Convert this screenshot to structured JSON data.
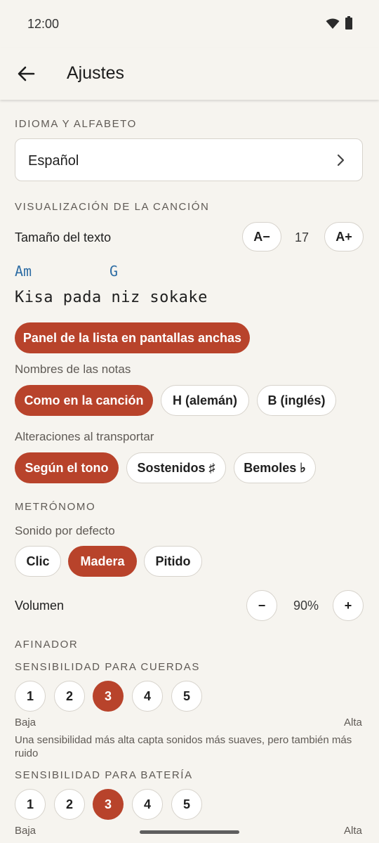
{
  "status": {
    "time": "12:00"
  },
  "header": {
    "title": "Ajustes"
  },
  "language": {
    "section": "IDIOMA Y ALFABETO",
    "value": "Español"
  },
  "display": {
    "section": "VISUALIZACIÓN DE LA CANCIÓN",
    "text_size_label": "Tamaño del texto",
    "decrease": "A−",
    "size_value": "17",
    "increase": "A+",
    "preview_chords": [
      "Am",
      "G"
    ],
    "preview_lyric": "Kisa pada niz sokake",
    "panel_button": "Panel de la lista en pantallas anchas",
    "note_names_label": "Nombres de las notas",
    "note_names": [
      {
        "label": "Como en la canción",
        "selected": true
      },
      {
        "label": "H (alemán)",
        "selected": false
      },
      {
        "label": "B (inglés)",
        "selected": false
      }
    ],
    "accidentals_label": "Alteraciones al transportar",
    "accidentals": [
      {
        "label": "Según el tono",
        "selected": true
      },
      {
        "label": "Sostenidos ♯",
        "selected": false
      },
      {
        "label": "Bemoles ♭",
        "selected": false
      }
    ]
  },
  "metronome": {
    "section": "METRÓNOMO",
    "default_sound_label": "Sonido por defecto",
    "sounds": [
      {
        "label": "Clic",
        "selected": false
      },
      {
        "label": "Madera",
        "selected": true
      },
      {
        "label": "Pitido",
        "selected": false
      }
    ],
    "volume_label": "Volumen",
    "volume_decrease": "−",
    "volume_value": "90%",
    "volume_increase": "+"
  },
  "tuner": {
    "section": "AFINADOR",
    "strings_section": "SENSIBILIDAD PARA CUERDAS",
    "strings_levels": [
      "1",
      "2",
      "3",
      "4",
      "5"
    ],
    "strings_selected": 3,
    "low": "Baja",
    "high": "Alta",
    "note": "Una sensibilidad más alta capta sonidos más suaves, pero también más ruido",
    "drums_section": "SENSIBILIDAD PARA BATERÍA",
    "drums_levels": [
      "1",
      "2",
      "3",
      "4",
      "5"
    ],
    "drums_selected": 3,
    "drums_low": "Baja",
    "drums_high": "Alta"
  },
  "colors": {
    "accent": "#b8432b",
    "chord": "#2e6da4",
    "background": "#f6f4ef"
  },
  "icons": {
    "back": "arrow-back-icon",
    "chevron": "chevron-right-icon",
    "wifi": "wifi-icon",
    "battery": "battery-icon"
  }
}
